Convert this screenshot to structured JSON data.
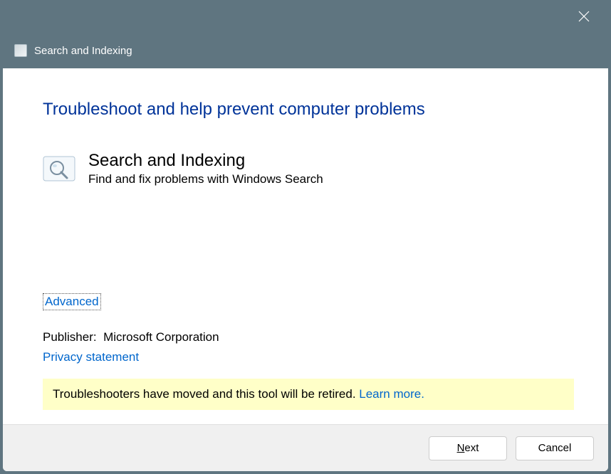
{
  "titlebar": {
    "close_tooltip": "Close"
  },
  "subheader": {
    "title": "Search and Indexing"
  },
  "main": {
    "heading": "Troubleshoot and help prevent computer problems",
    "item": {
      "title": "Search and Indexing",
      "description": "Find and fix problems with Windows Search"
    },
    "advanced_label": "Advanced",
    "publisher_label": "Publisher:",
    "publisher_value": "Microsoft Corporation",
    "privacy_label": "Privacy statement",
    "notice_text": "Troubleshooters have moved and this tool will be retired. ",
    "notice_link": "Learn more."
  },
  "footer": {
    "next_label": "Next",
    "cancel_label": "Cancel"
  }
}
